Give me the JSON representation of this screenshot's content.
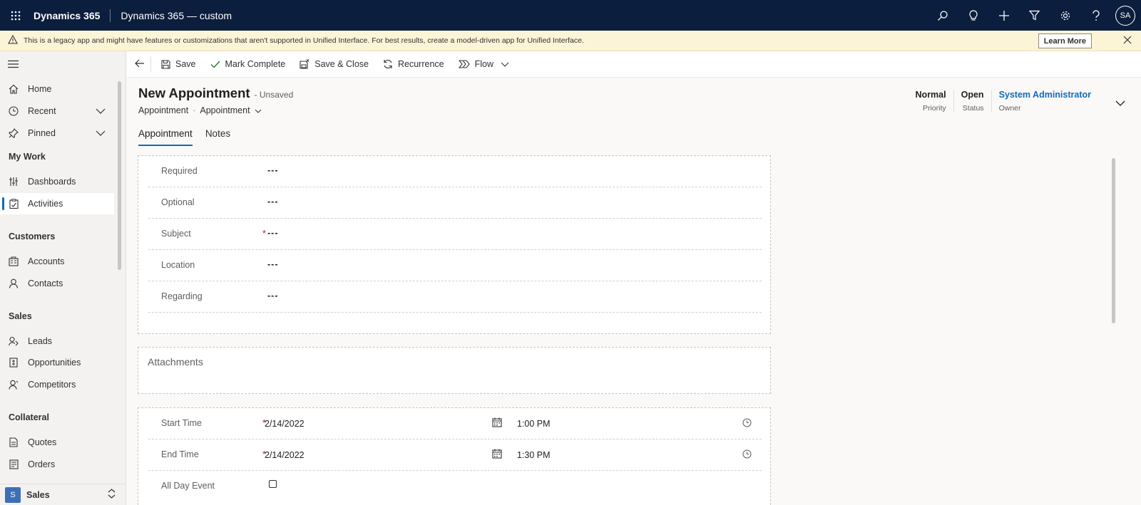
{
  "topbar": {
    "brand": "Dynamics 365",
    "app_name": "Dynamics 365 — custom",
    "avatar": "SA",
    "icons": [
      "waffle-icon",
      "search-icon",
      "lightbulb-icon",
      "plus-icon",
      "filter-icon",
      "gear-icon",
      "help-icon"
    ]
  },
  "banner": {
    "message": "This is a legacy app and might have features or customizations that aren't supported in Unified Interface. For best results, create a model-driven app for Unified Interface.",
    "learn_more": "Learn More"
  },
  "sidebar": {
    "items": [
      {
        "label": "Home",
        "icon": "home-icon"
      },
      {
        "label": "Recent",
        "icon": "clock-icon"
      },
      {
        "label": "Pinned",
        "icon": "pin-icon"
      }
    ],
    "groups": [
      {
        "title": "My Work",
        "items": [
          {
            "label": "Dashboards",
            "icon": "dashboard-icon"
          },
          {
            "label": "Activities",
            "icon": "activities-icon",
            "active": true
          }
        ]
      },
      {
        "title": "Customers",
        "items": [
          {
            "label": "Accounts",
            "icon": "accounts-icon"
          },
          {
            "label": "Contacts",
            "icon": "person-icon"
          }
        ]
      },
      {
        "title": "Sales",
        "items": [
          {
            "label": "Leads",
            "icon": "leads-icon"
          },
          {
            "label": "Opportunities",
            "icon": "opportunities-icon"
          },
          {
            "label": "Competitors",
            "icon": "competitors-icon"
          }
        ]
      },
      {
        "title": "Collateral",
        "items": [
          {
            "label": "Quotes",
            "icon": "quotes-icon"
          },
          {
            "label": "Orders",
            "icon": "orders-icon"
          }
        ]
      }
    ],
    "area": {
      "letter": "S",
      "label": "Sales"
    }
  },
  "commands": {
    "save": "Save",
    "mark_complete": "Mark Complete",
    "save_close": "Save & Close",
    "recurrence": "Recurrence",
    "flow": "Flow"
  },
  "record": {
    "title": "New Appointment",
    "state": "- Unsaved",
    "entity": "Appointment",
    "form": "Appointment"
  },
  "header_fields": {
    "priority": {
      "value": "Normal",
      "label": "Priority"
    },
    "status": {
      "value": "Open",
      "label": "Status"
    },
    "owner": {
      "value": "System Administrator",
      "label": "Owner"
    }
  },
  "tabs": [
    "Appointment",
    "Notes"
  ],
  "general_fields": [
    {
      "label": "Required",
      "value": "---",
      "required": false
    },
    {
      "label": "Optional",
      "value": "---",
      "required": false
    },
    {
      "label": "Subject",
      "value": "---",
      "required": true
    },
    {
      "label": "Location",
      "value": "---",
      "required": false
    },
    {
      "label": "Regarding",
      "value": "---",
      "required": false
    }
  ],
  "attachments": {
    "title": "Attachments"
  },
  "schedule": {
    "start": {
      "label": "Start Time",
      "date": "2/14/2022",
      "time": "1:00 PM",
      "required_mark": "*"
    },
    "end": {
      "label": "End Time",
      "date": "2/14/2022",
      "time": "1:30 PM",
      "required_mark": "*"
    },
    "all_day": {
      "label": "All Day Event",
      "checked": false
    }
  }
}
